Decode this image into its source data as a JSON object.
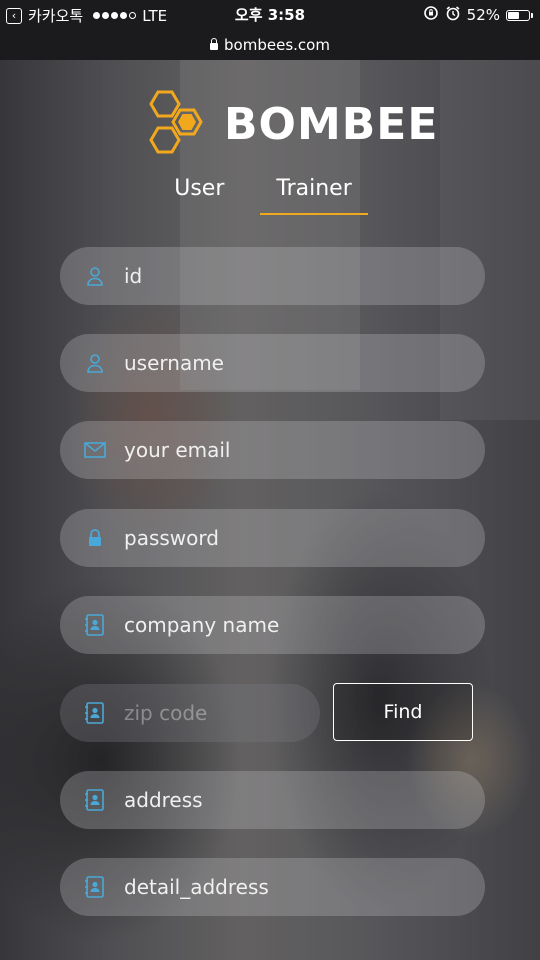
{
  "status_bar": {
    "back_app": "카카오톡",
    "network": "LTE",
    "time": "오후 3:58",
    "battery": "52%"
  },
  "url": "bombees.com",
  "brand": {
    "name": "BOMBEE",
    "accent": "#f2a81d"
  },
  "tabs": [
    {
      "label": "User",
      "active": false
    },
    {
      "label": "Trainer",
      "active": true
    }
  ],
  "fields": {
    "id": {
      "placeholder": "id",
      "icon": "user-icon"
    },
    "username": {
      "placeholder": "username",
      "icon": "user-icon"
    },
    "email": {
      "placeholder": "your email",
      "icon": "envelope-icon"
    },
    "password": {
      "placeholder": "password",
      "icon": "lock-icon"
    },
    "company": {
      "placeholder": "company name",
      "icon": "address-book-icon"
    },
    "zip": {
      "placeholder": "zip code",
      "icon": "address-book-icon"
    },
    "address": {
      "placeholder": "address",
      "icon": "address-book-icon"
    },
    "detail_address": {
      "placeholder": "detail_address",
      "icon": "address-book-icon"
    }
  },
  "find_button": "Find",
  "icon_color": "#4aa8d8"
}
